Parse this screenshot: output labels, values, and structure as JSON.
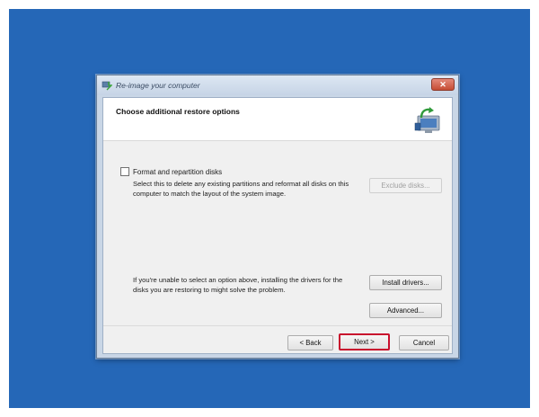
{
  "window": {
    "title": "Re-image your computer",
    "close_glyph": "✕"
  },
  "header": {
    "title": "Choose additional restore options",
    "icon": "computer-restore-icon"
  },
  "options": {
    "format_checkbox_label": "Format and repartition disks",
    "format_checked": false,
    "format_description": "Select this to delete any existing partitions and reformat all disks on this computer to match the layout of the system image.",
    "exclude_disks_label": "Exclude disks...",
    "drivers_description": "If you're unable to select an option above, installing the drivers for the disks you are restoring to might solve the problem.",
    "install_drivers_label": "Install drivers...",
    "advanced_label": "Advanced..."
  },
  "footer": {
    "back_label": "< Back",
    "next_label": "Next >",
    "cancel_label": "Cancel"
  },
  "colors": {
    "desktop": "#2567b7",
    "highlight": "#c8102e"
  }
}
